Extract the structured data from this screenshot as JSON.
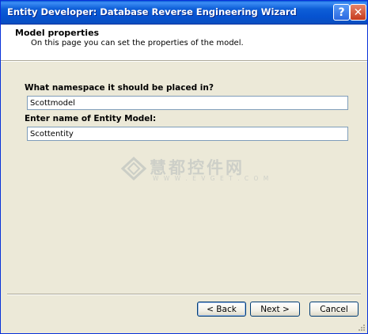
{
  "window": {
    "title": "Entity Developer: Database Reverse Engineering Wizard",
    "help_glyph": "?",
    "close_glyph": "✕"
  },
  "header": {
    "title": "Model properties",
    "subtitle": "On this page you can set the properties of the model."
  },
  "form": {
    "namespace_label": "What namespace it should be placed in?",
    "namespace_value": "Scottmodel",
    "entity_model_label": "Enter name of Entity Model:",
    "entity_model_value": "Scottentity"
  },
  "watermark": {
    "text": "慧都控件网",
    "url": "W W W . E V G E T . C O M"
  },
  "buttons": {
    "back": "< Back",
    "next": "Next >",
    "cancel": "Cancel"
  },
  "colors": {
    "titlebar": "#0a5ad6",
    "window_bg": "#ece9d8",
    "header_bg": "#ffffff",
    "input_border": "#7f9db9"
  }
}
